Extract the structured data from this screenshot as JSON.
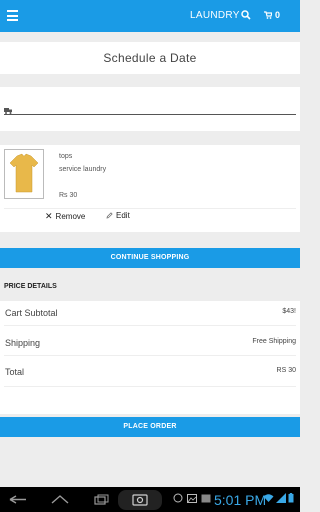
{
  "app_bar": {
    "title": "LAUNDRY",
    "cart_count": "0",
    "menu_icon": "menu-icon",
    "search_icon": "search-icon",
    "cart_icon": "cart-icon"
  },
  "schedule": {
    "label": "Schedule a Date"
  },
  "cart_item": {
    "name": "tops",
    "service": "service laundry",
    "price": "Rs 30",
    "remove_label": "Remove",
    "edit_label": "Edit",
    "image_icon": "tshirt-icon",
    "tshirt_color": "#e8b84a"
  },
  "continue_button": {
    "label": "CONTINUE SHOPPING"
  },
  "price_details": {
    "heading": "PRICE DETAILS",
    "rows": [
      {
        "label": "Cart Subtotal",
        "value": "$43!"
      },
      {
        "label": "Shipping",
        "value": "Free Shipping"
      },
      {
        "label": "Total",
        "value": "RS 30"
      }
    ]
  },
  "place_order": {
    "label": "PLACE ORDER"
  },
  "system_bar": {
    "time": "5:01 PM"
  },
  "colors": {
    "accent": "#1a9be6",
    "clock": "#3aa8e6"
  }
}
